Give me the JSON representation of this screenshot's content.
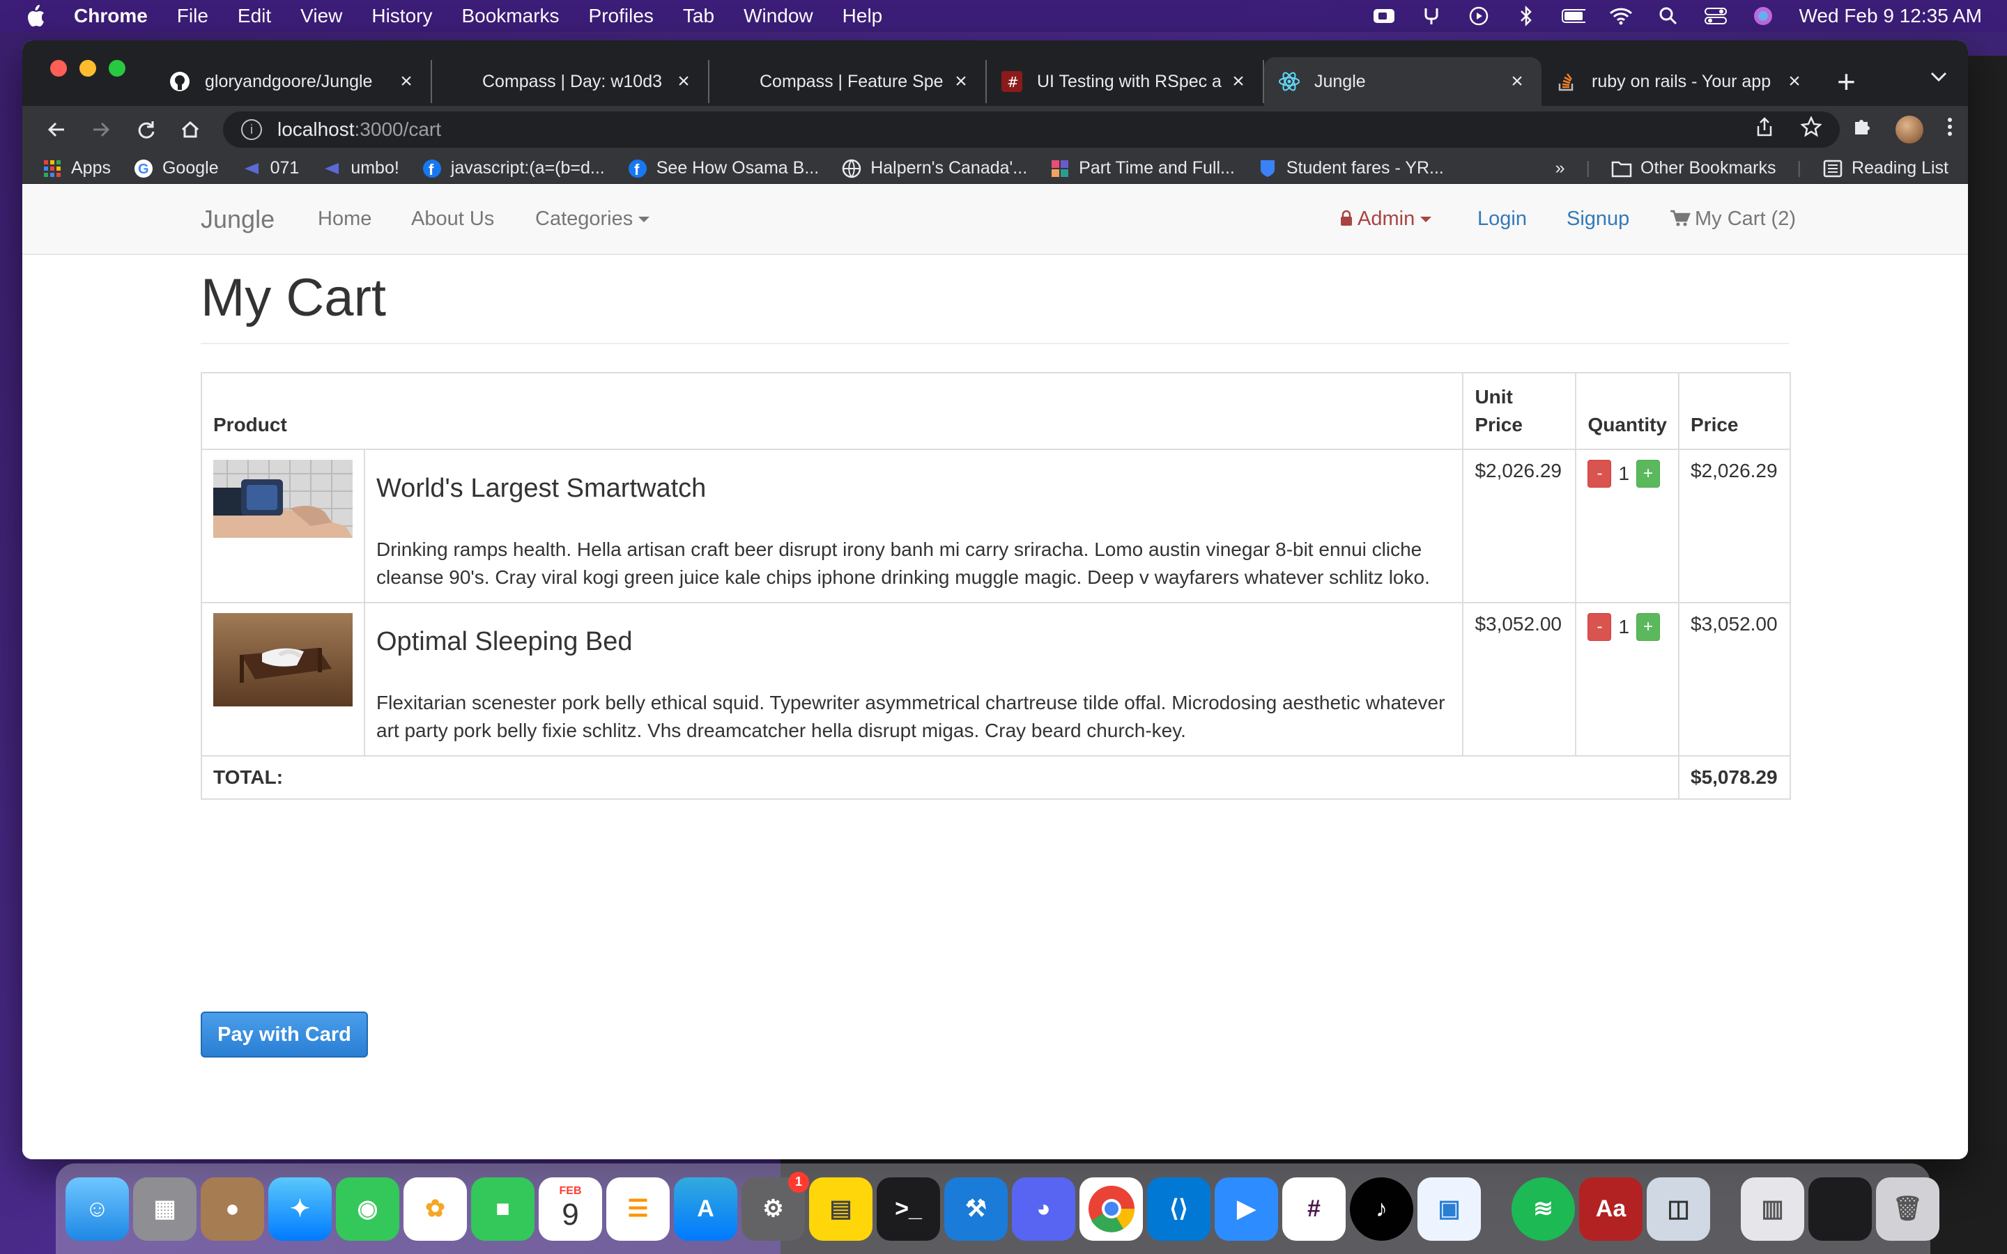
{
  "menubar": {
    "app_name": "Chrome",
    "items": [
      "File",
      "Edit",
      "View",
      "History",
      "Bookmarks",
      "Profiles",
      "Tab",
      "Window",
      "Help"
    ],
    "clock": "Wed Feb 9  12:35 AM"
  },
  "browser": {
    "tabs": [
      {
        "title": "gloryandgoore/Jungle",
        "icon": "github-icon"
      },
      {
        "title": "Compass | Day: w10d3",
        "icon": "compass-icon"
      },
      {
        "title": "Compass | Feature Spe",
        "icon": "compass-icon"
      },
      {
        "title": "UI Testing with RSpec a",
        "icon": "hash-icon"
      },
      {
        "title": "Jungle",
        "icon": "react-icon"
      },
      {
        "title": "ruby on rails - Your app",
        "icon": "stackoverflow-icon"
      }
    ],
    "active_tab_index": 4,
    "url_host": "localhost",
    "url_path": ":3000/cart",
    "bookmarks": [
      {
        "label": "Apps",
        "icon": "apps-grid-icon"
      },
      {
        "label": "Google",
        "icon": "google-icon"
      },
      {
        "label": "071",
        "icon": "triangle-icon"
      },
      {
        "label": "umbo!",
        "icon": "triangle-icon"
      },
      {
        "label": "javascript:(a=(b=d...",
        "icon": "facebook-icon"
      },
      {
        "label": "See How Osama B...",
        "icon": "facebook-icon"
      },
      {
        "label": "Halpern's Canada'...",
        "icon": "globe-icon"
      },
      {
        "label": "Part Time and Full...",
        "icon": "puzzle-icon"
      },
      {
        "label": "Student fares - YR...",
        "icon": "shield-icon"
      }
    ],
    "bookmarks_overflow": "»",
    "other_bookmarks": "Other Bookmarks",
    "reading_list": "Reading List"
  },
  "site_nav": {
    "brand": "Jungle",
    "home": "Home",
    "about": "About Us",
    "categories": "Categories",
    "admin": "Admin",
    "login": "Login",
    "signup": "Signup",
    "cart": "My Cart (2)"
  },
  "cart": {
    "title": "My Cart",
    "headers": {
      "product": "Product",
      "unit_price_1": "Unit",
      "unit_price_2": "Price",
      "quantity": "Quantity",
      "price": "Price"
    },
    "items": [
      {
        "name": "World's Largest Smartwatch",
        "description": "Drinking ramps health. Hella artisan craft beer disrupt irony banh mi carry sriracha. Lomo austin vinegar 8-bit ennui cliche cleanse 90's. Cray viral kogi green juice kale chips iphone drinking muggle magic. Deep v wayfarers whatever schlitz loko.",
        "unit_price": "$2,026.29",
        "quantity": "1",
        "price": "$2,026.29"
      },
      {
        "name": "Optimal Sleeping Bed",
        "description": "Flexitarian scenester pork belly ethical squid. Typewriter asymmetrical chartreuse tilde offal. Microdosing aesthetic whatever art party pork belly fixie schlitz. Vhs dreamcatcher hella disrupt migas. Cray beard church-key.",
        "unit_price": "$3,052.00",
        "quantity": "1",
        "price": "$3,052.00"
      }
    ],
    "minus_label": "-",
    "plus_label": "+",
    "total_label": "TOTAL:",
    "total_value": "$5,078.29",
    "pay_button": "Pay with Card"
  },
  "dock": {
    "badge_count": "1",
    "calendar_month": "FEB",
    "calendar_day": "9"
  },
  "colors": {
    "danger": "#d9534f",
    "success": "#5cb85c",
    "link": "#337ab7",
    "admin": "#a94442"
  }
}
